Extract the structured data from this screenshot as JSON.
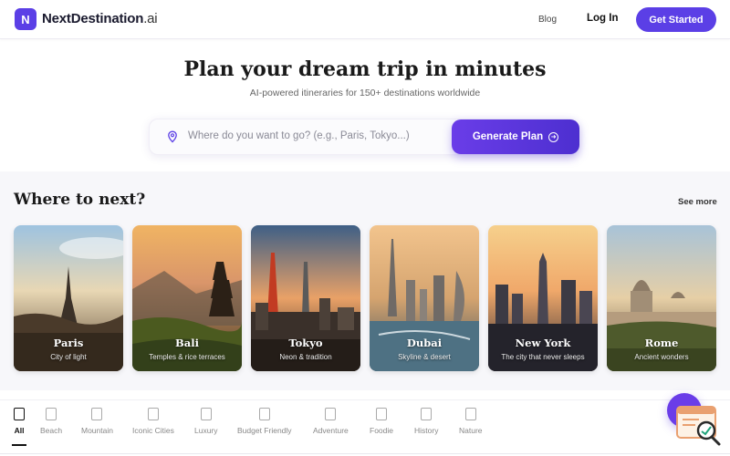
{
  "header": {
    "logo_letter": "N",
    "brand_name": "NextDestination",
    "brand_suffix": ".ai",
    "nav_blog": "Blog",
    "nav_login": "Log In",
    "cta": "Get Started",
    "brand_color": "#5b3fe6"
  },
  "hero": {
    "title": "Plan your dream trip in minutes",
    "subtitle": "AI-powered itineraries for 150+ destinations worldwide",
    "search_placeholder": "Where do you want to go? (e.g., Paris, Tokyo...)",
    "search_value": "",
    "generate_label": "Generate Plan",
    "pin_icon": "location-pin-icon",
    "arrow_icon": "arrow-right-circle-icon"
  },
  "destinations": {
    "title": "Where to next?",
    "see_more": "See more",
    "cards": [
      {
        "name": "Paris",
        "tagline": "City of light"
      },
      {
        "name": "Bali",
        "tagline": "Temples & rice terraces"
      },
      {
        "name": "Tokyo",
        "tagline": "Neon & tradition"
      },
      {
        "name": "Dubai",
        "tagline": "Skyline & desert"
      },
      {
        "name": "New York",
        "tagline": "The city that never sleeps"
      },
      {
        "name": "Rome",
        "tagline": "Ancient wonders"
      }
    ]
  },
  "categories": {
    "active": "All",
    "items": [
      {
        "label": "All"
      },
      {
        "label": "Beach"
      },
      {
        "label": "Mountain"
      },
      {
        "label": "Iconic Cities"
      },
      {
        "label": "Luxury"
      },
      {
        "label": "Budget Friendly"
      },
      {
        "label": "Adventure"
      },
      {
        "label": "Foodie"
      },
      {
        "label": "History"
      },
      {
        "label": "Nature"
      }
    ]
  },
  "chat": {
    "icon": "chat-bubble-icon",
    "helper_icon": "search-document-icon"
  }
}
